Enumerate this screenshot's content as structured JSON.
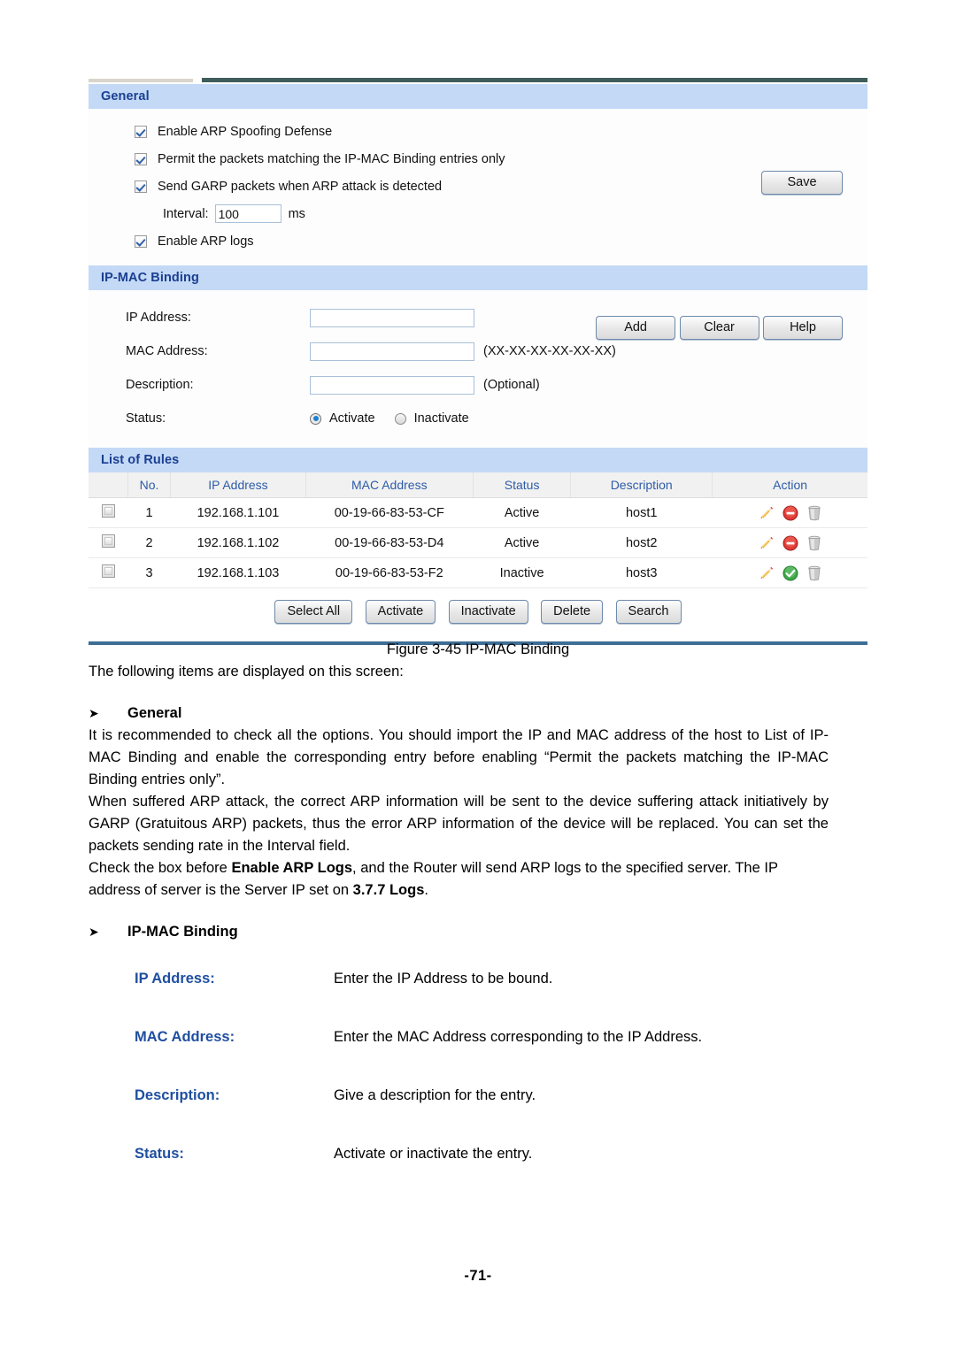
{
  "screenshot": {
    "general": {
      "title": "General",
      "options": [
        {
          "label": "Enable ARP Spoofing Defense",
          "checked": true
        },
        {
          "label": "Permit the packets matching the IP-MAC Binding entries only",
          "checked": true
        },
        {
          "label": "Send GARP packets when ARP attack is detected",
          "checked": true
        }
      ],
      "interval_label": "Interval:",
      "interval_value": "100",
      "interval_unit": "ms",
      "arp_logs": {
        "label": "Enable ARP logs",
        "checked": true
      },
      "save_button": "Save"
    },
    "binding": {
      "title": "IP-MAC Binding",
      "ip_label": "IP Address:",
      "ip_value": "",
      "mac_label": "MAC Address:",
      "mac_value": "",
      "mac_hint": "(XX-XX-XX-XX-XX-XX)",
      "desc_label": "Description:",
      "desc_value": "",
      "desc_hint": "(Optional)",
      "status_label": "Status:",
      "status_activate": "Activate",
      "status_inactivate": "Inactivate",
      "status_selected": "Activate",
      "buttons": [
        "Add",
        "Clear",
        "Help"
      ]
    },
    "rules": {
      "title": "List of Rules",
      "columns": [
        "",
        "No.",
        "IP Address",
        "MAC Address",
        "Status",
        "Description",
        "Action"
      ],
      "rows": [
        {
          "no": "1",
          "ip": "192.168.1.101",
          "mac": "00-19-66-83-53-CF",
          "status": "Active",
          "description": "host1",
          "action_toggle": "deactivate"
        },
        {
          "no": "2",
          "ip": "192.168.1.102",
          "mac": "00-19-66-83-53-D4",
          "status": "Active",
          "description": "host2",
          "action_toggle": "deactivate"
        },
        {
          "no": "3",
          "ip": "192.168.1.103",
          "mac": "00-19-66-83-53-F2",
          "status": "Inactive",
          "description": "host3",
          "action_toggle": "activate"
        }
      ],
      "toolbar": [
        "Select All",
        "Activate",
        "Inactivate",
        "Delete",
        "Search"
      ]
    },
    "colors": {
      "section_header_bg": "#c3d9f6",
      "section_header_text": "#1b3f91",
      "table_header_text": "#2d5ca8",
      "bottom_rule": "#3d6e96",
      "top_rule": "#3f5d5b"
    }
  },
  "doc": {
    "figure_caption": "Figure 3-45 IP-MAC Binding",
    "intro": "The following items are displayed on this screen:",
    "heading_general": "General",
    "arrow": "➤",
    "para1": "It is recommended to check all the options. You should import the IP and MAC address of the host to List of IP-MAC Binding and enable the corresponding entry before enabling “Permit the packets matching the IP-MAC Binding entries only”.",
    "para2": "When suffered ARP attack, the correct ARP information will be sent to the device suffering attack initiatively by GARP (Gratuitous ARP) packets, thus the error ARP information of the device will be replaced. You can set the packets sending rate in the Interval field.",
    "para3_a": "Check the box before ",
    "para3_b": "Enable ARP Logs",
    "para3_c": ", and the Router will send ARP logs to the specified server. The IP address of server is the Server IP set on ",
    "para3_d": "3.7.7 Logs",
    "para3_e": ".",
    "heading_binding": "IP-MAC Binding",
    "definitions": [
      {
        "term": "IP Address:",
        "desc": "Enter the IP Address to be bound."
      },
      {
        "term": "MAC Address:",
        "desc": "Enter the MAC Address corresponding to the IP Address."
      },
      {
        "term": "Description:",
        "desc": "Give a description for the entry."
      },
      {
        "term": "Status:",
        "desc": "Activate or inactivate the entry."
      }
    ],
    "page_number": "-71-"
  }
}
